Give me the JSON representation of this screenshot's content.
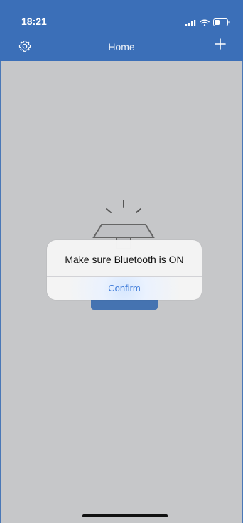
{
  "status_bar": {
    "time": "18:21"
  },
  "header": {
    "title": "Home"
  },
  "dialog": {
    "message": "Make sure Bluetooth is ON",
    "confirm_label": "Confirm"
  },
  "icons": {
    "settings": "settings-icon",
    "add": "add-icon",
    "signal": "signal-icon",
    "wifi": "wifi-icon",
    "battery": "battery-icon"
  },
  "colors": {
    "header_bg": "#3b6fb8",
    "screen_bg": "#c6c7c9",
    "dialog_bg": "#f4f4f4",
    "confirm_text": "#3c79d8"
  }
}
